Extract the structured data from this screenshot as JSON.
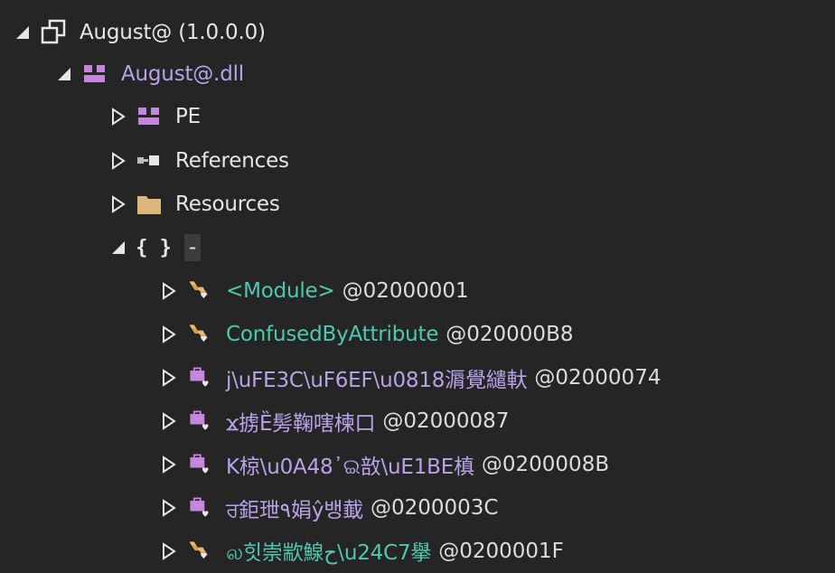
{
  "tree": {
    "assembly": {
      "label": "August@ (1.0.0.0)",
      "icon": "assembly-icon",
      "expanded": true
    },
    "module": {
      "label": "August@.dll",
      "icon": "module-icon",
      "expanded": true
    },
    "children": [
      {
        "label": "PE",
        "icon": "pe-icon",
        "expanded": false
      },
      {
        "label": "References",
        "icon": "references-icon",
        "expanded": false
      },
      {
        "label": "Resources",
        "icon": "folder-icon",
        "expanded": false
      }
    ],
    "namespace": {
      "label": "-",
      "icon": "namespace-braces-icon",
      "brace_text": "{ }",
      "expanded": true
    },
    "types": [
      {
        "name": "<Module>",
        "addr": "@02000001",
        "icon": "class-icon",
        "kind": "class"
      },
      {
        "name": "ConfusedByAttribute",
        "addr": "@020000B8",
        "icon": "class-icon",
        "kind": "class"
      },
      {
        "name": "j\\uFE3C\\uF6EF\\u0818漘覺繾軑",
        "addr": "@02000074",
        "icon": "struct-icon",
        "kind": "struct"
      },
      {
        "name": "ϫ掳Ȅ髣鞠嗐楝口",
        "addr": "@02000087",
        "icon": "struct-icon",
        "kind": "struct"
      },
      {
        "name": "K椋\\u0A48᾿ଇ敨\\uE1BE槙",
        "addr": "@0200008B",
        "icon": "struct-icon",
        "kind": "struct"
      },
      {
        "name": "ਰ鉅玴٩娟ŷ뱅韯",
        "addr": "@0200003C",
        "icon": "struct-icon",
        "kind": "struct"
      },
      {
        "name": "ல힛崇歂鰁ح\\u24C7擧",
        "addr": "@0200001F",
        "icon": "class-icon",
        "kind": "class"
      }
    ]
  },
  "colors": {
    "background": "#252526",
    "module_text": "#b8a3e8",
    "class_text": "#4ec9b0",
    "struct_text": "#b8a3e8",
    "text": "#dcdcdc"
  }
}
